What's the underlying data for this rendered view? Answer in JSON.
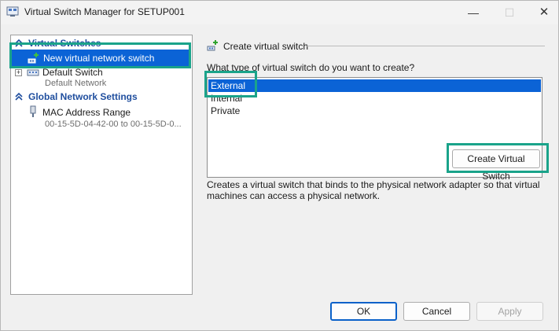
{
  "window": {
    "title": "Virtual Switch Manager for SETUP001",
    "min_glyph": "—",
    "max_glyph": "☐",
    "close_glyph": "✕"
  },
  "tree": {
    "virtual_switches_header": "Virtual Switches",
    "new_switch_label": "New virtual network switch",
    "default_switch": {
      "name": "Default Switch",
      "sub": "Default Network"
    },
    "global_settings_header": "Global Network Settings",
    "mac_range": {
      "name": "MAC Address Range",
      "sub": "00-15-5D-04-42-00 to 00-15-5D-0..."
    }
  },
  "create_panel": {
    "header": "Create virtual switch",
    "question": "What type of virtual switch do you want to create?",
    "options": [
      "External",
      "Internal",
      "Private"
    ],
    "selected_index": 0,
    "create_button": "Create Virtual Switch",
    "description": "Creates a virtual switch that binds to the physical network adapter so that virtual machines can access a physical network."
  },
  "footer": {
    "ok": "OK",
    "cancel": "Cancel",
    "apply": "Apply"
  },
  "colors": {
    "selection": "#0b63d6",
    "highlight": "#1aa38a",
    "header_blue": "#1f4e9e"
  }
}
